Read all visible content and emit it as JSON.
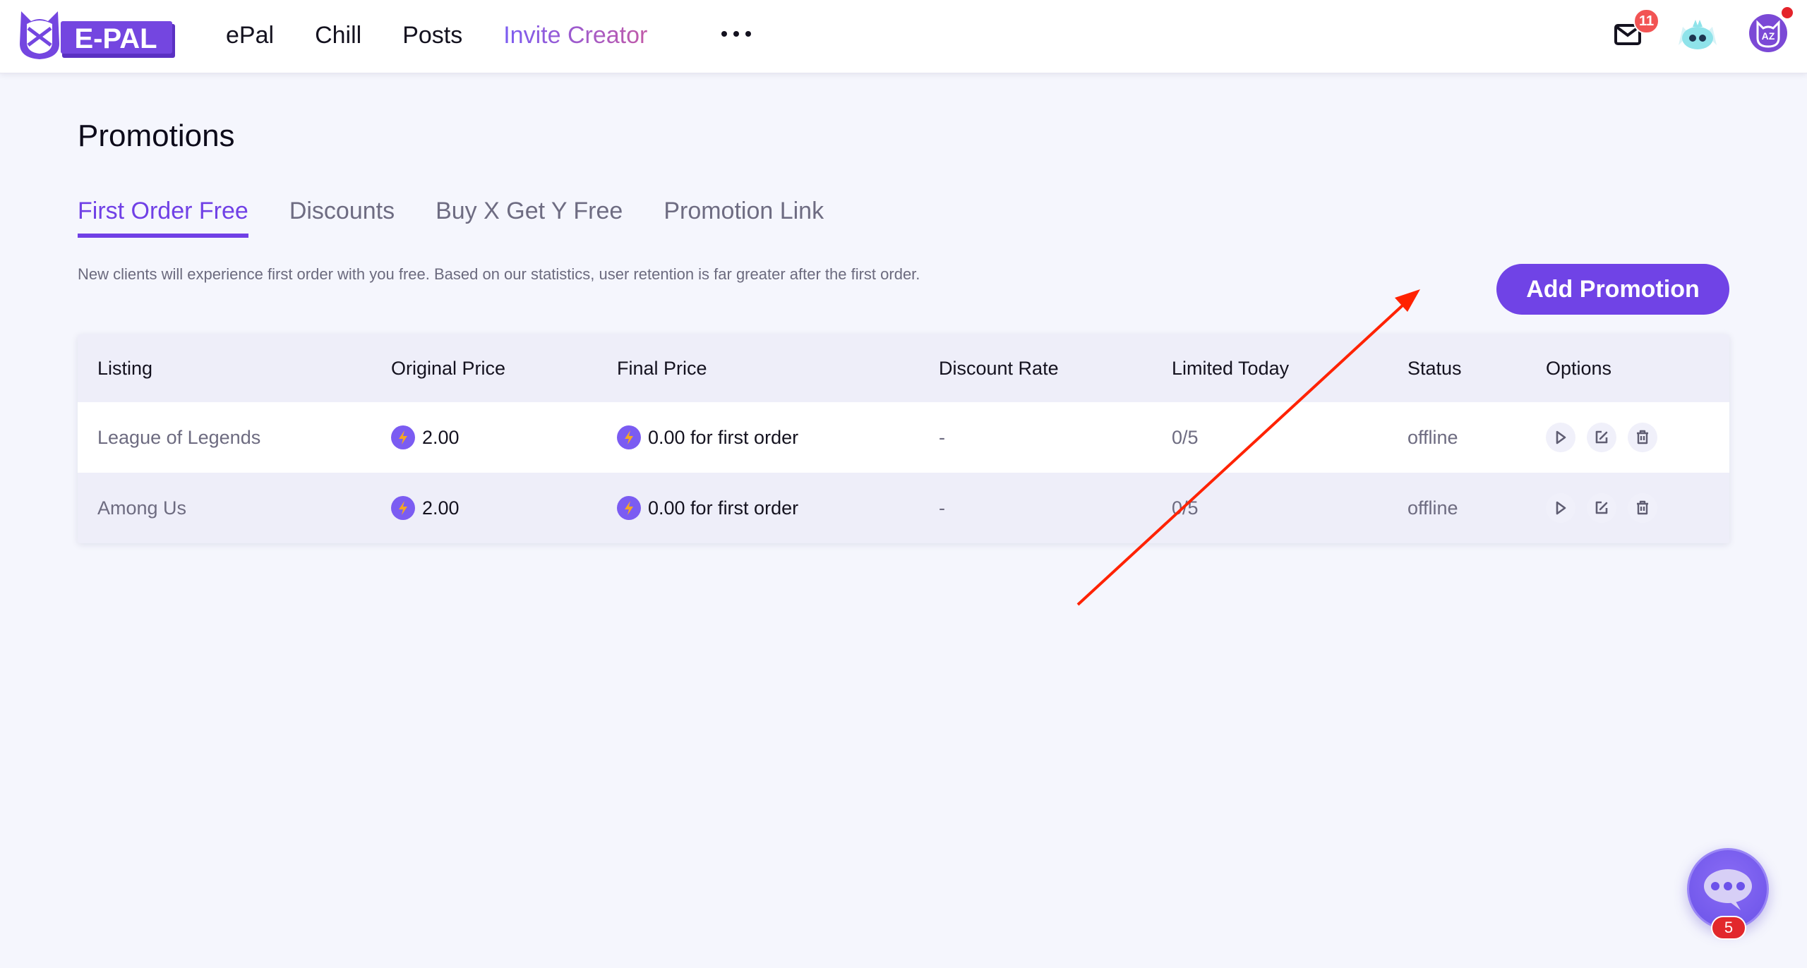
{
  "header": {
    "logo_text": "E-PAL",
    "nav": [
      {
        "label": "ePal"
      },
      {
        "label": "Chill"
      },
      {
        "label": "Posts"
      },
      {
        "label": "Invite Creator"
      }
    ],
    "more_icon": "more-horizontal-icon",
    "mail_badge": "11",
    "icons": [
      "mail-icon",
      "mascot-avatar",
      "user-avatar"
    ]
  },
  "page": {
    "title": "Promotions",
    "tabs": [
      {
        "label": "First Order Free",
        "active": true
      },
      {
        "label": "Discounts",
        "active": false
      },
      {
        "label": "Buy X Get Y Free",
        "active": false
      },
      {
        "label": "Promotion Link",
        "active": false
      }
    ],
    "description": "New clients will experience first order with you free. Based on our statistics, user retention is far greater after the first order.",
    "add_button": "Add Promotion"
  },
  "table": {
    "columns": [
      "Listing",
      "Original Price",
      "Final Price",
      "Discount Rate",
      "Limited Today",
      "Status",
      "Options"
    ],
    "rows": [
      {
        "listing": "League of Legends",
        "original_price": "2.00",
        "final_price": "0.00 for first order",
        "discount_rate": "-",
        "limited_today": "0/5",
        "status": "offline"
      },
      {
        "listing": "Among Us",
        "original_price": "2.00",
        "final_price": "0.00 for first order",
        "discount_rate": "-",
        "limited_today": "0/5",
        "status": "offline"
      }
    ],
    "option_icons": [
      "play-icon",
      "edit-icon",
      "trash-icon"
    ]
  },
  "chat": {
    "badge": "5"
  },
  "colors": {
    "accent": "#7043e6",
    "badge_red": "#f25454",
    "annotation_arrow": "#ff2200"
  }
}
